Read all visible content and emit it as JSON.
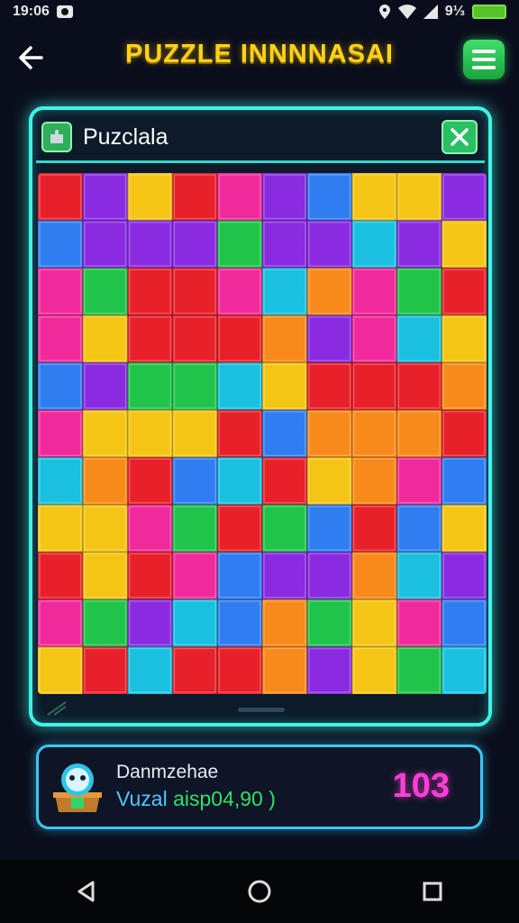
{
  "status_bar": {
    "time": "19:06",
    "battery": "",
    "signal_text": "9⅓"
  },
  "header": {
    "title": "PUZZLE INNNNASAI"
  },
  "panel": {
    "title": "Puzclala"
  },
  "puzzle": {
    "rows": 11,
    "cols": 10,
    "palette": [
      "#f5c516",
      "#8a2be2",
      "#21c44a",
      "#e8202a",
      "#2f7df0",
      "#f02a9a",
      "#19c0e0",
      "#f78a1a"
    ]
  },
  "player": {
    "name": "Danmzehae",
    "sub_prefix": "Vuzal",
    "sub_value": "aisp04,90 )",
    "score": "103"
  },
  "colors": {
    "accent_cyan": "#3ef3e6",
    "title_yellow": "#ffd21a",
    "score_pink": "#ff3fd6"
  }
}
